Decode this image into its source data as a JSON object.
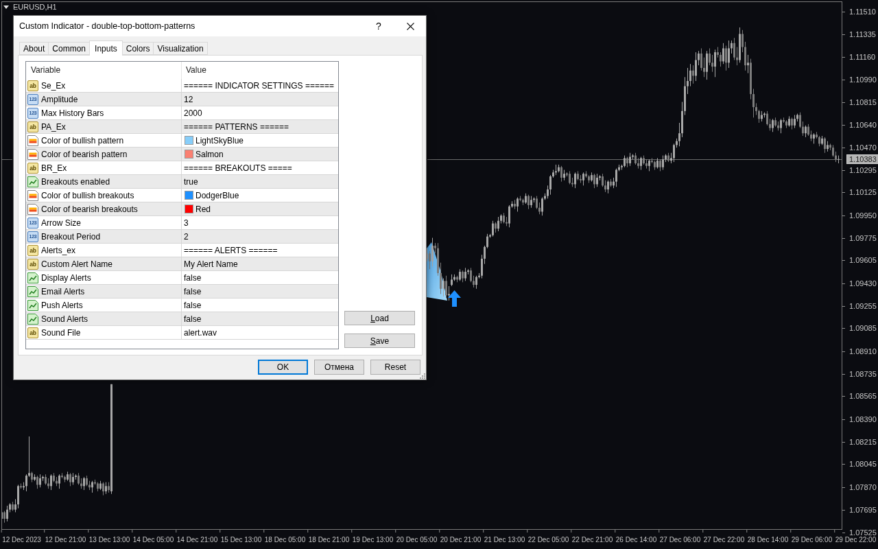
{
  "chart": {
    "symbol": "EURUSD,H1",
    "current_price": "1.10383",
    "bottom_price_label": "1.07525",
    "chart_data": {
      "type": "candlestick",
      "ylim": [
        1.07551,
        1.11584
      ],
      "yticks": [
        {
          "value": 1.1151,
          "label": "1.11510"
        },
        {
          "value": 1.11335,
          "label": "1.11335"
        },
        {
          "value": 1.1116,
          "label": "1.11160"
        },
        {
          "value": 1.1099,
          "label": "1.10990"
        },
        {
          "value": 1.10815,
          "label": "1.10815"
        },
        {
          "value": 1.1064,
          "label": "1.10640"
        },
        {
          "value": 1.1047,
          "label": "1.10470"
        },
        {
          "value": 1.10295,
          "label": "1.10295"
        },
        {
          "value": 1.10125,
          "label": "1.10125"
        },
        {
          "value": 1.0995,
          "label": "1.09950"
        },
        {
          "value": 1.09775,
          "label": "1.09775"
        },
        {
          "value": 1.09605,
          "label": "1.09605"
        },
        {
          "value": 1.0943,
          "label": "1.09430"
        },
        {
          "value": 1.09255,
          "label": "1.09255"
        },
        {
          "value": 1.09085,
          "label": "1.09085"
        },
        {
          "value": 1.0891,
          "label": "1.08910"
        },
        {
          "value": 1.08735,
          "label": "1.08735"
        },
        {
          "value": 1.08565,
          "label": "1.08565"
        },
        {
          "value": 1.0839,
          "label": "1.08390"
        },
        {
          "value": 1.08215,
          "label": "1.08215"
        },
        {
          "value": 1.08045,
          "label": "1.08045"
        },
        {
          "value": 1.0787,
          "label": "1.07870"
        },
        {
          "value": 1.07695,
          "label": "1.07695"
        }
      ],
      "categories": [
        null,
        null,
        null,
        null,
        null,
        null,
        null,
        "12 Dec 2023",
        null,
        null,
        null,
        null,
        null,
        null,
        null,
        null,
        null,
        null,
        null,
        null,
        null,
        null,
        null,
        "12 Dec 21:00",
        null,
        null,
        null,
        null,
        null,
        null,
        null,
        null,
        null,
        null,
        null,
        null,
        null,
        null,
        null,
        "13 Dec 13:00",
        null,
        null,
        null,
        null,
        null,
        null,
        null,
        null,
        null,
        null,
        null,
        null,
        null,
        null,
        null,
        "14 Dec 05:00",
        null,
        null,
        null,
        null,
        null,
        null,
        null,
        null,
        null,
        null,
        null,
        null,
        null,
        null,
        null,
        "14 Dec 21:00",
        null,
        null,
        null,
        null,
        null,
        null,
        null,
        null,
        null,
        null,
        null,
        null,
        null,
        null,
        null,
        "15 Dec 13:00",
        null,
        null,
        null,
        null,
        null,
        null,
        null,
        null,
        null,
        null,
        null,
        null,
        null,
        null,
        null,
        "18 Dec 05:00",
        null,
        null,
        null,
        null,
        null,
        null,
        null,
        null,
        null,
        null,
        null,
        null,
        null,
        null,
        null,
        "18 Dec 21:00",
        null,
        null,
        null,
        null,
        null,
        null,
        null,
        null,
        null,
        null,
        null,
        null,
        null,
        null,
        null,
        "19 Dec 13:00",
        null,
        null,
        null,
        null,
        null,
        null,
        null,
        null,
        null,
        null,
        null,
        null,
        null,
        null,
        null,
        "20 Dec 05:00",
        null,
        null,
        null,
        null,
        null,
        null,
        null,
        null,
        null,
        null,
        null,
        null,
        null,
        null,
        null,
        "20 Dec 21:00",
        null,
        null,
        null,
        null,
        null,
        null,
        null,
        null,
        null,
        null,
        null,
        null,
        null,
        null,
        null,
        "21 Dec 13:00",
        null,
        null,
        null,
        null,
        null,
        null,
        null,
        null,
        null,
        null,
        null,
        null,
        null,
        null,
        null,
        "22 Dec 05:00",
        null,
        null,
        null,
        null,
        null,
        null,
        null,
        null,
        null,
        null,
        null,
        null,
        null,
        null,
        null,
        "22 Dec 21:00",
        null,
        null,
        null,
        null,
        null,
        null,
        null,
        null,
        null,
        null,
        null,
        null,
        null,
        null,
        null,
        "26 Dec 14:00",
        null,
        null,
        null,
        null,
        null,
        null,
        null,
        null,
        null,
        null,
        null,
        null,
        null,
        null,
        null,
        "27 Dec 06:00",
        null,
        null,
        null,
        null,
        null,
        null,
        null,
        null,
        null,
        null,
        null,
        null,
        null,
        null,
        null,
        "27 Dec 22:00",
        null,
        null,
        null,
        null,
        null,
        null,
        null,
        null,
        null,
        null,
        null,
        null,
        null,
        null,
        null,
        "28 Dec 14:00",
        null,
        null,
        null,
        null,
        null,
        null,
        null,
        null,
        null,
        null,
        null,
        null,
        null,
        null,
        null,
        "29 Dec 06:00",
        null,
        null,
        null,
        null,
        null,
        null,
        null,
        null,
        null,
        null,
        null,
        null,
        null,
        null,
        null,
        "29 Dec 22:00"
      ],
      "ohlc": [
        [
          1.0763,
          1.077,
          1.0762,
          1.0768
        ],
        [
          1.0768,
          1.0769,
          1.076,
          1.0763
        ],
        [
          1.0763,
          1.0773,
          1.0761,
          1.077
        ],
        [
          1.077,
          1.0775,
          1.0768,
          1.0774
        ],
        [
          1.0774,
          1.0776,
          1.0769,
          1.077
        ],
        [
          1.077,
          1.0778,
          1.0768,
          1.0774
        ],
        [
          1.0774,
          1.0789,
          1.0771,
          1.0788
        ],
        [
          1.0788,
          1.079,
          1.0786,
          1.0787
        ],
        [
          1.0787,
          1.0791,
          1.0785,
          1.0788
        ],
        [
          1.0788,
          1.0797,
          1.0784,
          1.0796
        ],
        [
          1.0796,
          1.0826,
          1.0795,
          1.0798
        ],
        [
          1.0798,
          1.0799,
          1.0791,
          1.0793
        ],
        [
          1.0793,
          1.0797,
          1.0792,
          1.0795
        ],
        [
          1.0795,
          1.0796,
          1.0786,
          1.0789
        ],
        [
          1.0789,
          1.0797,
          1.0787,
          1.0794
        ],
        [
          1.0794,
          1.0796,
          1.0792,
          1.0795
        ],
        [
          1.0795,
          1.0797,
          1.0789,
          1.079
        ],
        [
          1.079,
          1.0794,
          1.0786,
          1.0788
        ],
        [
          1.0788,
          1.0797,
          1.0785,
          1.0796
        ],
        [
          1.0796,
          1.0798,
          1.0791,
          1.0792
        ],
        [
          1.0792,
          1.0795,
          1.0788,
          1.079
        ],
        [
          1.079,
          1.0797,
          1.0786,
          1.0796
        ],
        [
          1.0796,
          1.0798,
          1.0794,
          1.0795
        ],
        [
          1.0795,
          1.0796,
          1.0791,
          1.0793
        ],
        [
          1.0793,
          1.0799,
          1.0792,
          1.0797
        ],
        [
          1.0797,
          1.0798,
          1.0788,
          1.0791
        ],
        [
          1.0791,
          1.0798,
          1.0789,
          1.0795
        ],
        [
          1.0795,
          1.0797,
          1.0793,
          1.0796
        ],
        [
          1.0796,
          1.0798,
          1.0789,
          1.079
        ],
        [
          1.079,
          1.0794,
          1.0786,
          1.0788
        ],
        [
          1.0788,
          1.0795,
          1.0785,
          1.0794
        ],
        [
          1.0794,
          1.0796,
          1.0788,
          1.0789
        ],
        [
          1.0789,
          1.0792,
          1.0785,
          1.0787
        ],
        [
          1.0787,
          1.0792,
          1.0783,
          1.0791
        ],
        [
          1.0791,
          1.0793,
          1.0789,
          1.079
        ],
        [
          1.079,
          1.0791,
          1.0784,
          1.0786
        ],
        [
          1.0786,
          1.0792,
          1.0785,
          1.079
        ],
        [
          1.079,
          1.0791,
          1.0781,
          1.0784
        ],
        [
          1.0784,
          1.0791,
          1.0782,
          1.0788
        ],
        [
          1.0788,
          1.0791,
          1.0783,
          1.0785
        ],
        [
          1.0784,
          1.0866,
          1.0782,
          1.0866
        ],
        null,
        null,
        null,
        null,
        null,
        null,
        null,
        null,
        null,
        null,
        null,
        null,
        null,
        null,
        null,
        null,
        null,
        null,
        null,
        null,
        null,
        null,
        null,
        null,
        null,
        null,
        null,
        null,
        null,
        null,
        null,
        null,
        null,
        null,
        null,
        null,
        null,
        null,
        null,
        null,
        null,
        null,
        null,
        null,
        null,
        null,
        null,
        null,
        null,
        null,
        null,
        null,
        null,
        null,
        null,
        null,
        null,
        null,
        null,
        null,
        null,
        null,
        null,
        null,
        null,
        null,
        null,
        null,
        null,
        null,
        null,
        null,
        null,
        null,
        null,
        null,
        null,
        null,
        null,
        null,
        null,
        null,
        null,
        null,
        null,
        null,
        null,
        null,
        null,
        null,
        null,
        null,
        null,
        null,
        null,
        null,
        null,
        null,
        null,
        null,
        null,
        null,
        null,
        null,
        null,
        null,
        null,
        null,
        null,
        null,
        null,
        null,
        null,
        null,
        [
          1.0962,
          1.097,
          1.096,
          1.0966
        ],
        [
          1.0966,
          1.0968,
          1.0954,
          1.096
        ],
        [
          1.096,
          1.0978,
          1.0956,
          1.0972
        ],
        [
          1.0972,
          1.0974,
          1.0966,
          1.097
        ],
        [
          1.097,
          1.0974,
          1.0949,
          1.0951
        ],
        [
          1.0951,
          1.0959,
          1.0935,
          1.0939
        ],
        [
          1.0939,
          1.0947,
          1.0933,
          1.0945
        ],
        [
          1.0945,
          1.0949,
          1.0932,
          1.0934
        ],
        [
          1.0934,
          1.0941,
          1.093,
          1.0935
        ],
        [
          1.0942,
          1.095,
          1.0941,
          1.0946
        ],
        [
          1.0946,
          1.095,
          1.0945,
          1.0948
        ],
        [
          1.0948,
          1.0949,
          1.0944,
          1.0946
        ],
        [
          1.0946,
          1.0954,
          1.0945,
          1.0952
        ],
        [
          1.0952,
          1.0953,
          1.0944,
          1.0947
        ],
        [
          1.0947,
          1.0955,
          1.0945,
          1.0952
        ],
        [
          1.0952,
          1.0954,
          1.095,
          1.0953
        ],
        [
          1.0953,
          1.0955,
          1.0944,
          1.0945
        ],
        [
          1.0945,
          1.0949,
          1.094,
          1.0942
        ],
        [
          1.0942,
          1.0949,
          1.0939,
          1.0948
        ],
        [
          1.0948,
          1.0951,
          1.0947,
          1.0949
        ],
        [
          1.0949,
          1.0965,
          1.0947,
          1.0962
        ],
        [
          1.0962,
          1.0972,
          1.0958,
          1.0971
        ],
        [
          1.0971,
          1.0981,
          1.097,
          1.0979
        ],
        [
          1.0979,
          1.0981,
          1.0978,
          1.098
        ],
        [
          1.098,
          1.0991,
          1.0979,
          1.0989
        ],
        [
          1.0989,
          1.099,
          1.0982,
          1.0985
        ],
        [
          1.0985,
          1.0994,
          1.0983,
          1.0991
        ],
        [
          1.0991,
          1.0996,
          1.0989,
          1.0995
        ],
        [
          1.0995,
          1.0997,
          1.0989,
          1.099
        ],
        [
          1.099,
          1.0994,
          1.0987,
          1.0989
        ],
        [
          1.0989,
          1.1003,
          1.0986,
          1.1002
        ],
        [
          1.1002,
          1.1006,
          1.1001,
          1.1004
        ],
        [
          1.1004,
          1.1007,
          1.1,
          1.1002
        ],
        [
          1.1002,
          1.1009,
          1.0998,
          1.1008
        ],
        [
          1.1008,
          1.101,
          1.1006,
          1.1007
        ],
        [
          1.1007,
          1.1008,
          1.1003,
          1.1005
        ],
        [
          1.1005,
          1.1012,
          1.1004,
          1.101
        ],
        [
          1.101,
          1.1011,
          1.1,
          1.1003
        ],
        [
          1.1003,
          1.101,
          1.1001,
          1.1007
        ],
        [
          1.1007,
          1.1009,
          1.1005,
          1.1008
        ],
        [
          1.1008,
          1.101,
          1.1,
          1.1001
        ],
        [
          1.1001,
          1.1005,
          1.0996,
          1.0998
        ],
        [
          1.0998,
          1.1009,
          1.0995,
          1.1008
        ],
        [
          1.1008,
          1.1012,
          1.1007,
          1.101
        ],
        [
          1.101,
          1.1018,
          1.1008,
          1.1015
        ],
        [
          1.1015,
          1.1026,
          1.1011,
          1.1025
        ],
        [
          1.1025,
          1.103,
          1.1024,
          1.1028
        ],
        [
          1.1028,
          1.1034,
          1.1026,
          1.1029
        ],
        [
          1.1029,
          1.1034,
          1.1028,
          1.1032
        ],
        [
          1.1032,
          1.1033,
          1.1021,
          1.1024
        ],
        [
          1.1024,
          1.103,
          1.1022,
          1.1027
        ],
        [
          1.1027,
          1.1028,
          1.1025,
          1.1027
        ],
        [
          1.1027,
          1.1029,
          1.1019,
          1.102
        ],
        [
          1.102,
          1.1024,
          1.1017,
          1.1019
        ],
        [
          1.1019,
          1.1028,
          1.1016,
          1.1027
        ],
        [
          1.1027,
          1.1029,
          1.1022,
          1.1023
        ],
        [
          1.1023,
          1.1026,
          1.102,
          1.1022
        ],
        [
          1.1022,
          1.1028,
          1.1018,
          1.1027
        ],
        [
          1.1027,
          1.1029,
          1.1024,
          1.1025
        ],
        [
          1.1025,
          1.1026,
          1.102,
          1.1022
        ],
        [
          1.1022,
          1.1028,
          1.1021,
          1.1026
        ],
        [
          1.1026,
          1.1027,
          1.1016,
          1.1019
        ],
        [
          1.1019,
          1.1027,
          1.1017,
          1.1024
        ],
        [
          1.1024,
          1.1026,
          1.1022,
          1.1025
        ],
        [
          1.1025,
          1.1027,
          1.1017,
          1.1018
        ],
        [
          1.1018,
          1.1022,
          1.1013,
          1.1015
        ],
        [
          1.1015,
          1.1022,
          1.1012,
          1.1021
        ],
        [
          1.1021,
          1.1023,
          1.1017,
          1.1018
        ],
        [
          1.1018,
          1.1024,
          1.1016,
          1.1021
        ],
        [
          1.1021,
          1.1031,
          1.1017,
          1.103
        ],
        [
          1.103,
          1.1034,
          1.1029,
          1.1032
        ],
        [
          1.1032,
          1.1034,
          1.103,
          1.1033
        ],
        [
          1.1033,
          1.1041,
          1.1032,
          1.1039
        ],
        [
          1.1039,
          1.104,
          1.1032,
          1.1035
        ],
        [
          1.1035,
          1.1043,
          1.1033,
          1.104
        ],
        [
          1.104,
          1.1042,
          1.1038,
          1.1041
        ],
        [
          1.1041,
          1.1043,
          1.1034,
          1.1035
        ],
        [
          1.1035,
          1.1039,
          1.1031,
          1.1033
        ],
        [
          1.1033,
          1.104,
          1.103,
          1.1039
        ],
        [
          1.1039,
          1.1041,
          1.1034,
          1.1035
        ],
        [
          1.1035,
          1.1038,
          1.1031,
          1.1033
        ],
        [
          1.1033,
          1.1038,
          1.1029,
          1.1037
        ],
        [
          1.1037,
          1.1039,
          1.1035,
          1.1036
        ],
        [
          1.1036,
          1.1037,
          1.103,
          1.1032
        ],
        [
          1.1032,
          1.1039,
          1.1031,
          1.1037
        ],
        [
          1.1037,
          1.1038,
          1.1029,
          1.1032
        ],
        [
          1.1032,
          1.1041,
          1.103,
          1.1038
        ],
        [
          1.1038,
          1.1042,
          1.1036,
          1.1041
        ],
        [
          1.1041,
          1.1043,
          1.1036,
          1.1037
        ],
        [
          1.1037,
          1.1043,
          1.1035,
          1.1039
        ],
        [
          1.1039,
          1.105,
          1.1036,
          1.1049
        ],
        [
          1.1049,
          1.1054,
          1.1047,
          1.1052
        ],
        [
          1.1052,
          1.1066,
          1.1048,
          1.1058
        ],
        [
          1.1058,
          1.1082,
          1.1055,
          1.1075
        ],
        [
          1.1075,
          1.1101,
          1.1072,
          1.1094
        ],
        [
          1.1094,
          1.1108,
          1.1088,
          1.1098
        ],
        [
          1.1098,
          1.1111,
          1.1094,
          1.1106
        ],
        [
          1.1106,
          1.111,
          1.1096,
          1.1102
        ],
        [
          1.1102,
          1.112,
          1.1098,
          1.1114
        ],
        [
          1.1114,
          1.1121,
          1.111,
          1.1119
        ],
        [
          1.1119,
          1.1123,
          1.1106,
          1.1108
        ],
        [
          1.1108,
          1.1116,
          1.1101,
          1.1105
        ],
        [
          1.1105,
          1.1121,
          1.1099,
          1.1119
        ],
        [
          1.1119,
          1.1123,
          1.111,
          1.1112
        ],
        [
          1.1112,
          1.1118,
          1.1105,
          1.1109
        ],
        [
          1.1109,
          1.1122,
          1.1101,
          1.112
        ],
        [
          1.112,
          1.1124,
          1.1116,
          1.1118
        ],
        [
          1.1118,
          1.112,
          1.1109,
          1.1113
        ],
        [
          1.1113,
          1.1127,
          1.1111,
          1.1123
        ],
        [
          1.1123,
          1.1125,
          1.1106,
          1.1112
        ],
        [
          1.1112,
          1.1129,
          1.1108,
          1.1123
        ],
        [
          1.1123,
          1.1129,
          1.1119,
          1.1127
        ],
        [
          1.1127,
          1.1131,
          1.1114,
          1.1116
        ],
        [
          1.1116,
          1.1124,
          1.111,
          1.1114
        ],
        [
          1.1114,
          1.1139,
          1.1112,
          1.1134
        ],
        [
          1.1134,
          1.1137,
          1.112,
          1.1124
        ],
        [
          1.1124,
          1.1128,
          1.1106,
          1.111
        ],
        [
          1.111,
          1.1118,
          1.1104,
          1.1112
        ],
        [
          1.1112,
          1.1115,
          1.1084,
          1.1088
        ],
        [
          1.1088,
          1.1092,
          1.107,
          1.1078
        ],
        [
          1.1078,
          1.1081,
          1.1072,
          1.1075
        ],
        [
          1.1075,
          1.1076,
          1.1066,
          1.1069
        ],
        [
          1.1069,
          1.1075,
          1.1067,
          1.1072
        ],
        [
          1.1072,
          1.1074,
          1.107,
          1.1073
        ],
        [
          1.1073,
          1.1075,
          1.1064,
          1.1065
        ],
        [
          1.1065,
          1.1069,
          1.106,
          1.1062
        ],
        [
          1.1062,
          1.1069,
          1.1059,
          1.1068
        ],
        [
          1.1068,
          1.107,
          1.1063,
          1.1064
        ],
        [
          1.1064,
          1.1067,
          1.106,
          1.1062
        ],
        [
          1.1062,
          1.1069,
          1.1058,
          1.1068
        ],
        [
          1.1068,
          1.107,
          1.1066,
          1.1067
        ],
        [
          1.1067,
          1.1068,
          1.1062,
          1.1064
        ],
        [
          1.1064,
          1.1071,
          1.1063,
          1.1069
        ],
        [
          1.1069,
          1.107,
          1.1061,
          1.1064
        ],
        [
          1.1064,
          1.1072,
          1.1062,
          1.1069
        ],
        [
          1.1069,
          1.1073,
          1.1067,
          1.1072
        ],
        [
          1.1072,
          1.1074,
          1.1062,
          1.1063
        ],
        [
          1.1063,
          1.1067,
          1.1056,
          1.1058
        ],
        [
          1.1058,
          1.1064,
          1.1055,
          1.1063
        ],
        [
          1.1063,
          1.1065,
          1.1056,
          1.1057
        ],
        [
          1.1057,
          1.106,
          1.1052,
          1.1054
        ],
        [
          1.1054,
          1.1058,
          1.105,
          1.1057
        ],
        [
          1.1057,
          1.1059,
          1.1054,
          1.1055
        ],
        [
          1.1055,
          1.1056,
          1.1048,
          1.105
        ],
        [
          1.105,
          1.1056,
          1.1049,
          1.1054
        ],
        [
          1.1054,
          1.1055,
          1.1043,
          1.1046
        ],
        [
          1.1046,
          1.1052,
          1.1044,
          1.1049
        ],
        [
          1.1049,
          1.105,
          1.1045,
          1.1047
        ],
        [
          1.1047,
          1.1049,
          1.104,
          1.1041
        ],
        [
          1.1041,
          1.1044,
          1.1036,
          1.1038
        ],
        [
          1.1038,
          1.1041,
          1.1035,
          1.10383
        ],
        null,
        null,
        null,
        null,
        null,
        null
      ]
    }
  },
  "dialog": {
    "title": "Custom Indicator - double-top-bottom-patterns",
    "help_button": "?",
    "tabs": [
      {
        "label": "About",
        "selected": false
      },
      {
        "label": "Common",
        "selected": false
      },
      {
        "label": "Inputs",
        "selected": true
      },
      {
        "label": "Colors",
        "selected": false
      },
      {
        "label": "Visualization",
        "selected": false
      }
    ],
    "columns": [
      "Variable",
      "Value"
    ],
    "rows": [
      {
        "kind": "string",
        "type_tag": "ab",
        "variable": "Se_Ex",
        "value": "====== INDICATOR SETTINGS ======"
      },
      {
        "kind": "int",
        "type_tag": "123",
        "variable": "Amplitude",
        "value": "12"
      },
      {
        "kind": "int",
        "type_tag": "123",
        "variable": "Max History Bars",
        "value": "2000"
      },
      {
        "kind": "string",
        "type_tag": "ab",
        "variable": "PA_Ex",
        "value": "====== PATTERNS ======"
      },
      {
        "kind": "color",
        "variable": "Color of bullish pattern",
        "value": "LightSkyBlue",
        "color": "#87cefa"
      },
      {
        "kind": "color",
        "variable": "Color of bearish pattern",
        "value": "Salmon",
        "color": "#fa8072"
      },
      {
        "kind": "string",
        "type_tag": "ab",
        "variable": "BR_Ex",
        "value": "====== BREAKOUTS ====="
      },
      {
        "kind": "bool",
        "variable": "Breakouts enabled",
        "value": "true"
      },
      {
        "kind": "color",
        "variable": "Color of bullish breakouts",
        "value": "DodgerBlue",
        "color": "#1e90ff"
      },
      {
        "kind": "color",
        "variable": "Color of bearish breakouts",
        "value": "Red",
        "color": "#ff0000"
      },
      {
        "kind": "int",
        "type_tag": "123",
        "variable": "Arrow Size",
        "value": "3"
      },
      {
        "kind": "int",
        "type_tag": "123",
        "variable": "Breakout Period",
        "value": "2"
      },
      {
        "kind": "string",
        "type_tag": "ab",
        "variable": "Alerts_ex",
        "value": "====== ALERTS ======"
      },
      {
        "kind": "string",
        "type_tag": "ab",
        "variable": "Custom Alert Name",
        "value": "My Alert Name"
      },
      {
        "kind": "bool",
        "variable": "Display Alerts",
        "value": "false"
      },
      {
        "kind": "bool",
        "variable": "Email Alerts",
        "value": "false"
      },
      {
        "kind": "bool",
        "variable": "Push Alerts",
        "value": "false"
      },
      {
        "kind": "bool",
        "variable": "Sound Alerts",
        "value": "false"
      },
      {
        "kind": "string",
        "type_tag": "ab",
        "variable": "Sound File",
        "value": "alert.wav"
      }
    ],
    "side_buttons": [
      "Load",
      "Save"
    ],
    "buttons": [
      {
        "label": "OK",
        "default": true
      },
      {
        "label": "Отмена",
        "default": false
      },
      {
        "label": "Reset",
        "default": false
      }
    ]
  }
}
